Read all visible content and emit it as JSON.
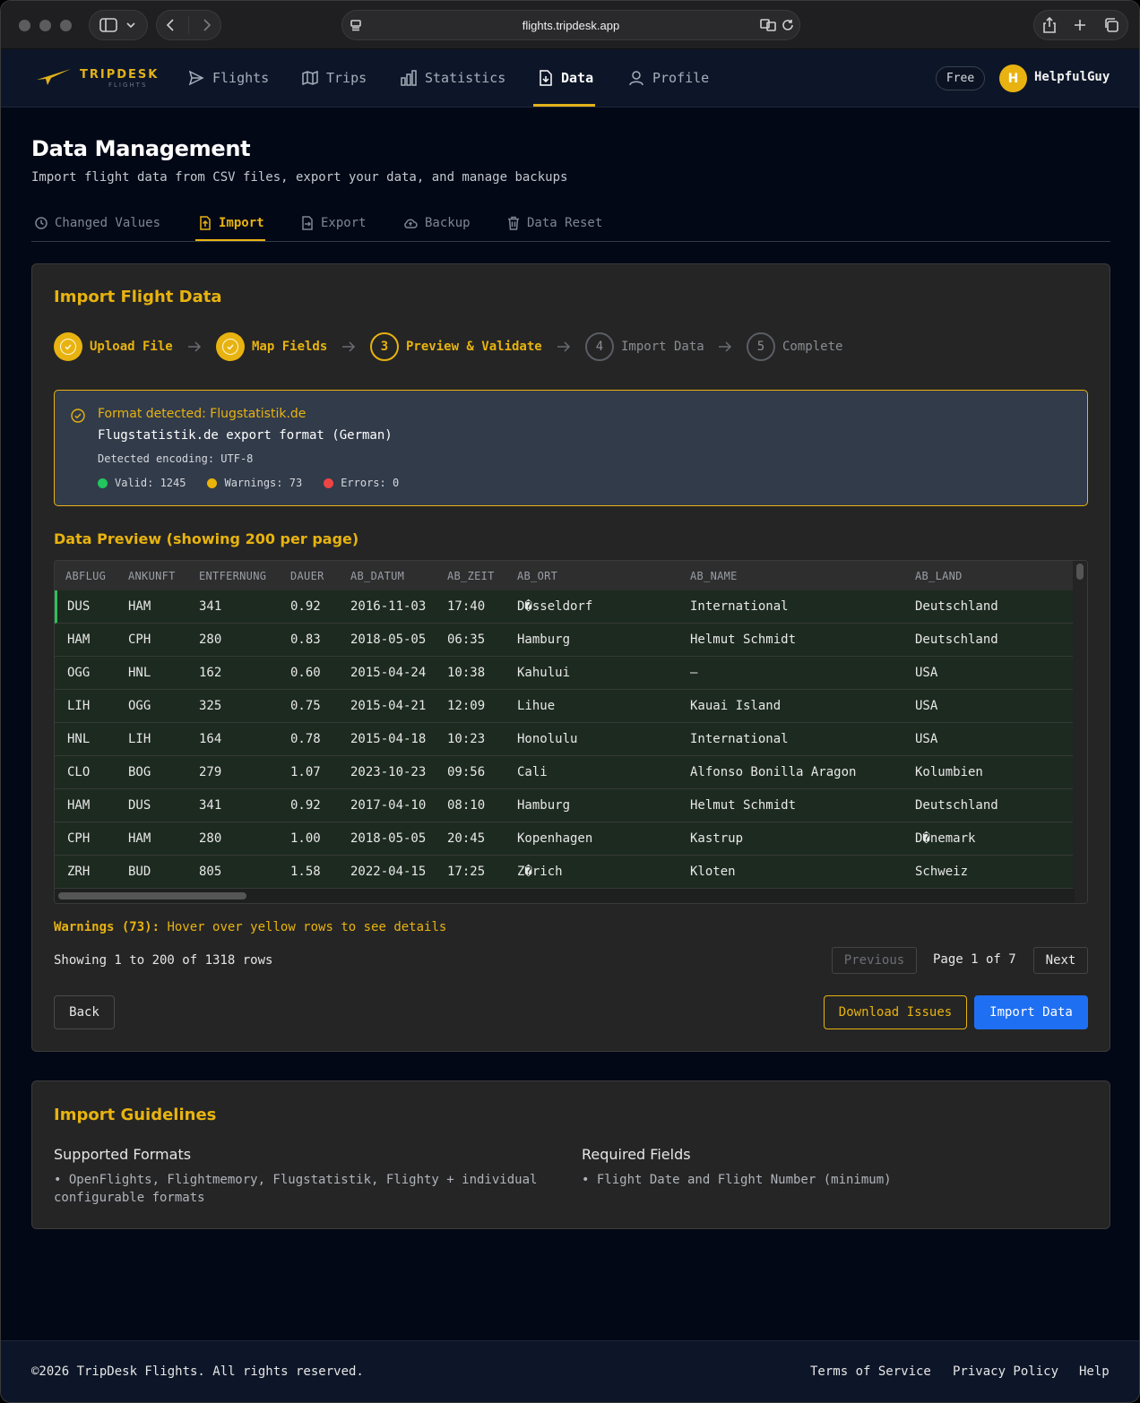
{
  "browser": {
    "url": "flights.tripdesk.app"
  },
  "nav": {
    "logo": "TRIPDESK",
    "logo_sub": "FLIGHTS",
    "items": [
      {
        "label": "Flights",
        "icon": "paper-plane-icon"
      },
      {
        "label": "Trips",
        "icon": "map-icon"
      },
      {
        "label": "Statistics",
        "icon": "bar-chart-icon"
      },
      {
        "label": "Data",
        "icon": "file-download-icon",
        "active": true
      },
      {
        "label": "Profile",
        "icon": "user-icon"
      }
    ],
    "plan_badge": "Free",
    "avatar_initial": "H",
    "username": "HelpfulGuy"
  },
  "page": {
    "title": "Data Management",
    "subtitle": "Import flight data from CSV files, export your data, and manage backups",
    "tabs": [
      {
        "label": "Changed Values",
        "icon": "clock-icon"
      },
      {
        "label": "Import",
        "icon": "file-upload-icon",
        "active": true
      },
      {
        "label": "Export",
        "icon": "file-export-icon"
      },
      {
        "label": "Backup",
        "icon": "cloud-icon"
      },
      {
        "label": "Data Reset",
        "icon": "trash-icon"
      }
    ]
  },
  "import": {
    "title": "Import Flight Data",
    "steps": [
      {
        "number": "1",
        "label": "Upload File",
        "state": "done"
      },
      {
        "number": "2",
        "label": "Map Fields",
        "state": "done"
      },
      {
        "number": "3",
        "label": "Preview & Validate",
        "state": "current"
      },
      {
        "number": "4",
        "label": "Import Data",
        "state": "todo"
      },
      {
        "number": "5",
        "label": "Complete",
        "state": "todo"
      }
    ],
    "format": {
      "detected": "Format detected: Flugstatistik.de",
      "name": "Flugstatistik.de export format (German)",
      "encoding": "Detected encoding: UTF-8",
      "valid": "Valid: 1245",
      "warnings": "Warnings: 73",
      "errors": "Errors: 0",
      "colors": {
        "valid": "#22c55e",
        "warnings": "#eab308",
        "errors": "#ef4444"
      }
    },
    "preview_title": "Data Preview (showing 200 per page)",
    "table": {
      "columns": [
        "ABFLUG",
        "ANKUNFT",
        "ENTFERNUNG",
        "DAUER",
        "AB_DATUM",
        "AB_ZEIT",
        "AB_ORT",
        "AB_NAME",
        "AB_LAND"
      ],
      "rows": [
        [
          "DUS",
          "HAM",
          "341",
          "0.92",
          "2016-11-03",
          "17:40",
          "D�sseldorf",
          "International",
          "Deutschland"
        ],
        [
          "HAM",
          "CPH",
          "280",
          "0.83",
          "2018-05-05",
          "06:35",
          "Hamburg",
          "Helmut Schmidt",
          "Deutschland"
        ],
        [
          "OGG",
          "HNL",
          "162",
          "0.60",
          "2015-04-24",
          "10:38",
          "Kahului",
          "—",
          "USA"
        ],
        [
          "LIH",
          "OGG",
          "325",
          "0.75",
          "2015-04-21",
          "12:09",
          "Lihue",
          "Kauai Island",
          "USA"
        ],
        [
          "HNL",
          "LIH",
          "164",
          "0.78",
          "2015-04-18",
          "10:23",
          "Honolulu",
          "International",
          "USA"
        ],
        [
          "CLO",
          "BOG",
          "279",
          "1.07",
          "2023-10-23",
          "09:56",
          "Cali",
          "Alfonso Bonilla Aragon",
          "Kolumbien"
        ],
        [
          "HAM",
          "DUS",
          "341",
          "0.92",
          "2017-04-10",
          "08:10",
          "Hamburg",
          "Helmut Schmidt",
          "Deutschland"
        ],
        [
          "CPH",
          "HAM",
          "280",
          "1.00",
          "2018-05-05",
          "20:45",
          "Kopenhagen",
          "Kastrup",
          "D�nemark"
        ],
        [
          "ZRH",
          "BUD",
          "805",
          "1.58",
          "2022-04-15",
          "17:25",
          "Z�rich",
          "Kloten",
          "Schweiz"
        ]
      ]
    },
    "warnings_prefix": "Warnings (73):",
    "warnings_text": "Hover over yellow rows to see details",
    "showing": "Showing 1 to 200 of 1318 rows",
    "pagination": {
      "previous": "Previous",
      "page": "Page 1 of 7",
      "next": "Next"
    },
    "buttons": {
      "back": "Back",
      "download": "Download Issues",
      "import": "Import Data"
    }
  },
  "guidelines": {
    "title": "Import Guidelines",
    "supported_title": "Supported Formats",
    "supported_line1": "• OpenFlights, Flightmemory, Flugstatistik, Flighty + individual",
    "supported_line2": "configurable formats",
    "required_title": "Required Fields",
    "required_text": "• Flight Date and Flight Number (minimum)"
  },
  "footer": {
    "copyright": "©2026 TripDesk Flights. All rights reserved.",
    "links": [
      "Terms of Service",
      "Privacy Policy",
      "Help"
    ]
  }
}
